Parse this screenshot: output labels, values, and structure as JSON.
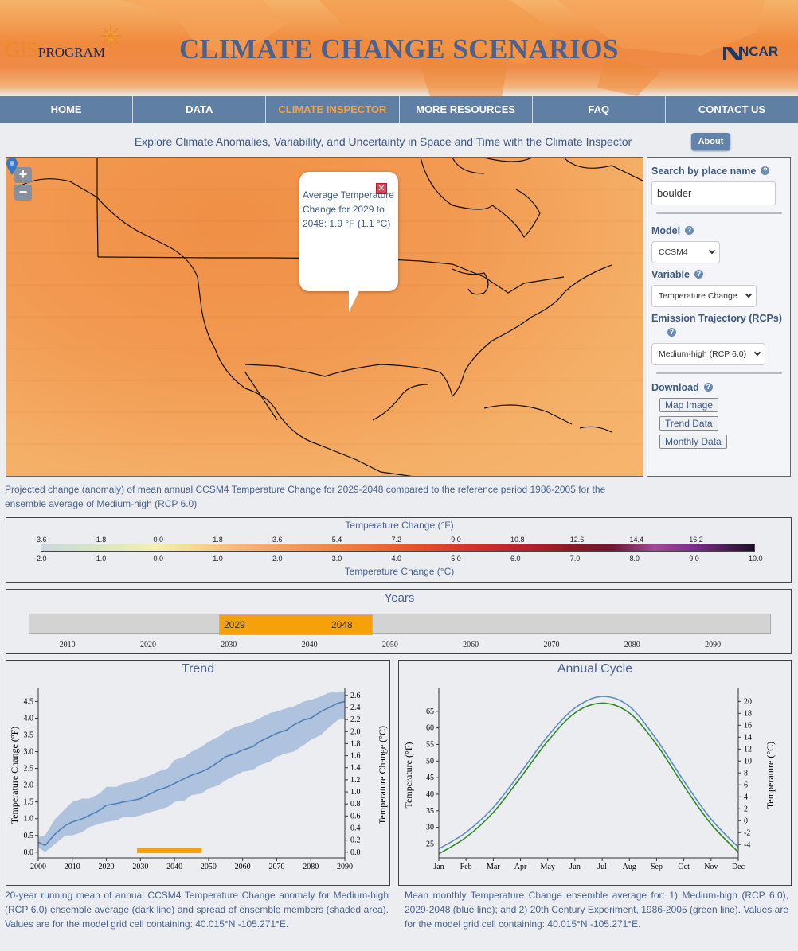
{
  "header": {
    "gis_logo": "GIS",
    "gis_logo_sub": "PROGRAM",
    "site_title": "CLIMATE CHANGE SCENARIOS",
    "ncar_logo": "NCAR"
  },
  "nav": {
    "items": [
      "HOME",
      "DATA",
      "CLIMATE INSPECTOR",
      "MORE RESOURCES",
      "FAQ",
      "CONTACT US"
    ],
    "active": "CLIMATE INSPECTOR"
  },
  "subtitle": "Explore Climate Anomalies, Variability, and Uncertainty in Space and Time with the Climate Inspector",
  "about_label": "About",
  "map": {
    "zoom_in": "+",
    "zoom_out": "−",
    "popup_text": "Average Temperature Change for 2029 to 2048: 1.9 °F (1.1 °C)",
    "popup_close": "✕"
  },
  "side": {
    "search_label": "Search by place name",
    "search_value": "boulder",
    "model_label": "Model",
    "model_value": "CCSM4",
    "variable_label": "Variable",
    "variable_value": "Temperature Change",
    "emission_label": "Emission Trajectory (RCPs)",
    "emission_value": "Medium-high (RCP 6.0)",
    "download_label": "Download",
    "download_buttons": [
      "Map Image",
      "Trend Data",
      "Monthly Data"
    ]
  },
  "map_caption": "Projected change (anomaly) of mean annual CCSM4 Temperature Change for 2029-2048 compared to the reference period 1986-2005 for the ensemble average of Medium-high (RCP 6.0)",
  "legend": {
    "title_f": "Temperature Change (°F)",
    "title_c": "Temperature Change (°C)",
    "ticks_f": [
      "-3.6",
      "-1.8",
      "0.0",
      "1.8",
      "3.6",
      "5.4",
      "7.2",
      "9.0",
      "10.8",
      "12.6",
      "14.4",
      "16.2"
    ],
    "ticks_c": [
      "-2.0",
      "-1.0",
      "0.0",
      "1.0",
      "2.0",
      "3.0",
      "4.0",
      "5.0",
      "6.0",
      "7.0",
      "8.0",
      "9.0",
      "10.0"
    ]
  },
  "years": {
    "title": "Years",
    "range_start": "2029",
    "range_end": "2048",
    "ticks": [
      "2010",
      "2020",
      "2030",
      "2040",
      "2050",
      "2060",
      "2070",
      "2080",
      "2090"
    ]
  },
  "chart_data": [
    {
      "type": "line",
      "title": "Trend",
      "xlabel": "",
      "ylabel": "Temperature Change (°F)",
      "ylabel_right": "Temperature Change (°C)",
      "xlim": [
        2000,
        2090
      ],
      "ylim": [
        -0.1,
        4.7
      ],
      "x_ticks": [
        2000,
        2010,
        2020,
        2030,
        2040,
        2050,
        2060,
        2070,
        2080,
        2090
      ],
      "y_ticks": [
        0.0,
        0.5,
        1.0,
        1.5,
        2.0,
        2.5,
        3.0,
        3.5,
        4.0,
        4.5
      ],
      "y_ticks_right": [
        0.0,
        0.2,
        0.4,
        0.6,
        0.8,
        1.0,
        1.2,
        1.4,
        1.6,
        1.8,
        2.0,
        2.2,
        2.4,
        2.6
      ],
      "series": [
        {
          "x": [
            2000,
            2002,
            2005,
            2008,
            2010,
            2013,
            2015,
            2018,
            2020,
            2023,
            2025,
            2028,
            2030,
            2033,
            2035,
            2038,
            2040,
            2043,
            2045,
            2048,
            2050,
            2053,
            2055,
            2058,
            2060,
            2063,
            2065,
            2068,
            2070,
            2073,
            2075,
            2078,
            2080,
            2083,
            2085,
            2088,
            2090
          ],
          "y": [
            0.3,
            0.2,
            0.55,
            0.8,
            0.9,
            1.0,
            1.1,
            1.25,
            1.4,
            1.45,
            1.5,
            1.55,
            1.6,
            1.75,
            1.85,
            1.95,
            2.05,
            2.2,
            2.3,
            2.4,
            2.5,
            2.7,
            2.85,
            2.95,
            3.05,
            3.15,
            3.3,
            3.45,
            3.55,
            3.65,
            3.8,
            3.95,
            4.0,
            4.2,
            4.3,
            4.45,
            4.5
          ],
          "upper": [
            0.45,
            0.5,
            1.0,
            1.3,
            1.5,
            1.6,
            1.6,
            1.75,
            1.95,
            1.95,
            2.05,
            2.1,
            2.2,
            2.3,
            2.4,
            2.5,
            2.75,
            2.85,
            3.0,
            3.15,
            3.3,
            3.45,
            3.6,
            3.75,
            3.8,
            3.9,
            4.0,
            4.15,
            4.2,
            4.3,
            4.35,
            4.5,
            4.55,
            4.65,
            4.75,
            4.8,
            4.8
          ],
          "lower": [
            0.15,
            0.0,
            0.25,
            0.5,
            0.5,
            0.6,
            0.75,
            0.85,
            0.9,
            0.95,
            1.05,
            1.05,
            1.1,
            1.2,
            1.25,
            1.35,
            1.5,
            1.55,
            1.7,
            1.75,
            1.9,
            2.0,
            2.15,
            2.3,
            2.4,
            2.45,
            2.6,
            2.7,
            2.85,
            2.95,
            3.0,
            3.2,
            3.35,
            3.5,
            3.7,
            3.95,
            4.0
          ]
        }
      ],
      "highlight_range": [
        2029,
        2048
      ]
    },
    {
      "type": "line",
      "title": "Annual Cycle",
      "xlabel": "",
      "ylabel": "Temperature (°F)",
      "ylabel_right": "Temperature (°C)",
      "categories": [
        "Jan",
        "Feb",
        "Mar",
        "Apr",
        "May",
        "Jun",
        "Jul",
        "Aug",
        "Sep",
        "Oct",
        "Nov",
        "Dec"
      ],
      "ylim": [
        21.5,
        70
      ],
      "y_ticks": [
        25,
        30,
        35,
        40,
        45,
        50,
        55,
        60,
        65
      ],
      "y_ticks_right": [
        -4,
        -2,
        0,
        2,
        4,
        6,
        8,
        10,
        12,
        14,
        16,
        18,
        20
      ],
      "series": [
        {
          "color": "#5b8ec4",
          "values": [
            23.5,
            28.5,
            36.0,
            46.5,
            57.5,
            66.0,
            69.5,
            66.5,
            56.5,
            44.0,
            32.5,
            24.0
          ]
        },
        {
          "color": "#2f8a24",
          "values": [
            22.0,
            27.0,
            34.5,
            45.0,
            56.0,
            64.5,
            67.5,
            64.5,
            55.0,
            42.5,
            31.0,
            22.5
          ]
        }
      ]
    }
  ],
  "trend_caption": "20-year running mean of annual CCSM4 Temperature Change anomaly for Medium-high (RCP 6.0) ensemble average (dark line) and spread of ensemble members (shaded area). Values are for the model grid cell containing: 40.015°N -105.271°E.",
  "cycle_caption": "Mean monthly Temperature Change ensemble average for: 1) Medium-high (RCP 6.0), 2029-2048 (blue line); and 2) 20th Century Experiment, 1986-2005 (green line). Values are for the model grid cell containing: 40.015°N -105.271°E."
}
